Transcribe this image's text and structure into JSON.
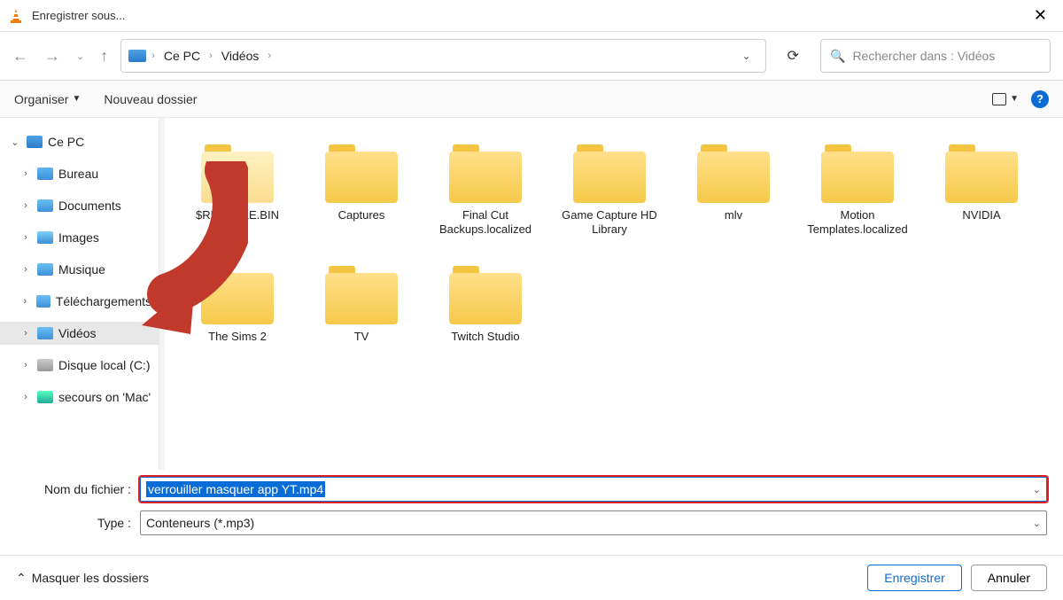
{
  "window": {
    "title": "Enregistrer sous..."
  },
  "breadcrumb": {
    "root": "Ce PC",
    "current": "Vidéos"
  },
  "search": {
    "placeholder": "Rechercher dans : Vidéos"
  },
  "toolbar": {
    "organize": "Organiser",
    "new_folder": "Nouveau dossier"
  },
  "sidebar": {
    "root": "Ce PC",
    "items": [
      {
        "label": "Bureau",
        "icon": "ic-desktop"
      },
      {
        "label": "Documents",
        "icon": "ic-doc"
      },
      {
        "label": "Images",
        "icon": "ic-img"
      },
      {
        "label": "Musique",
        "icon": "ic-music"
      },
      {
        "label": "Téléchargements",
        "icon": "ic-dl"
      },
      {
        "label": "Vidéos",
        "icon": "ic-video",
        "selected": true
      },
      {
        "label": "Disque local (C:)",
        "icon": "ic-disk"
      },
      {
        "label": "secours on 'Mac'",
        "icon": "ic-net"
      }
    ]
  },
  "folders": [
    {
      "label": "$RECYCLE.BIN",
      "sel": true
    },
    {
      "label": "Captures"
    },
    {
      "label": "Final Cut Backups.localized"
    },
    {
      "label": "Game Capture HD Library"
    },
    {
      "label": "mlv"
    },
    {
      "label": "Motion Templates.localized"
    },
    {
      "label": "NVIDIA"
    },
    {
      "label": "The Sims 2"
    },
    {
      "label": "TV"
    },
    {
      "label": "Twitch Studio"
    }
  ],
  "fields": {
    "filename_label": "Nom du fichier :",
    "filename_value": "verrouiller masquer app YT.mp4",
    "type_label": "Type :",
    "type_value": "Conteneurs (*.mp3)"
  },
  "footer": {
    "hide_folders": "Masquer les dossiers",
    "save": "Enregistrer",
    "cancel": "Annuler"
  }
}
